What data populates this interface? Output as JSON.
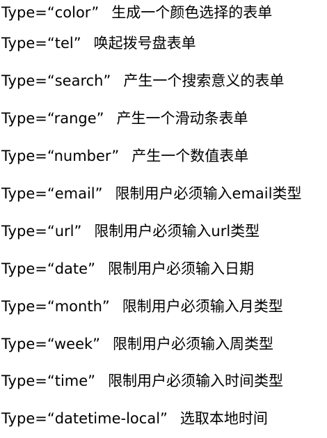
{
  "rows": [
    {
      "keyword": "Type",
      "eq": "=",
      "value": "“color”",
      "desc": "生成一个颜色选择的表单"
    },
    {
      "keyword": "Type",
      "eq": "=",
      "value": "“tel”",
      "desc": "唤起拨号盘表单"
    },
    {
      "keyword": "Type",
      "eq": "=",
      "value": "“search”",
      "desc": "产生一个搜索意义的表单"
    },
    {
      "keyword": "Type",
      "eq": "=",
      "value": "“range”",
      "desc": "产生一个滑动条表单"
    },
    {
      "keyword": "Type",
      "eq": "=",
      "value": "“number”",
      "desc": "产生一个数值表单"
    },
    {
      "keyword": "Type",
      "eq": "=",
      "value": "“email”",
      "desc": "限制用户必须输入email类型"
    },
    {
      "keyword": "Type",
      "eq": "=",
      "value": "“url”",
      "desc": "限制用户必须输入url类型"
    },
    {
      "keyword": "Type",
      "eq": "=",
      "value": "“date”",
      "desc": "限制用户必须输入日期"
    },
    {
      "keyword": "Type",
      "eq": "=",
      "value": "“month”",
      "desc": "限制用户必须输入月类型"
    },
    {
      "keyword": "Type",
      "eq": "=",
      "value": "“week”",
      "desc": "限制用户必须输入周类型"
    },
    {
      "keyword": "Type",
      "eq": "=",
      "value": "“time”",
      "desc": "限制用户必须输入时间类型"
    },
    {
      "keyword": "Type",
      "eq": "=",
      "value": "“datetime-local”",
      "desc": "选取本地时间"
    }
  ]
}
